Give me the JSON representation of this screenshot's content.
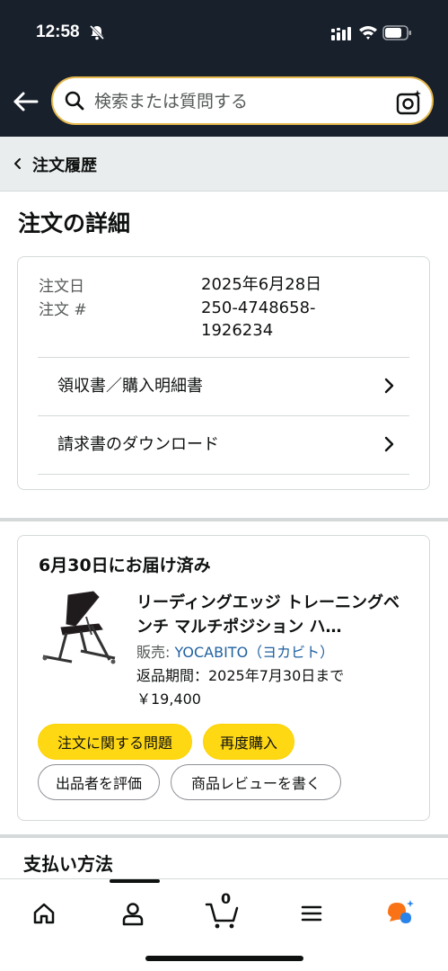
{
  "status_bar": {
    "time": "12:58"
  },
  "search": {
    "placeholder": "検索または質問する"
  },
  "breadcrumb": {
    "label": "注文履歴"
  },
  "page": {
    "title": "注文の詳細"
  },
  "order_info": {
    "date_label": "注文日",
    "date_value": "2025年6月28日",
    "number_label": "注文 #",
    "number_value_line1": "250-4748658-",
    "number_value_line2": "1926234",
    "links": [
      {
        "label": "領収書／購入明細書"
      },
      {
        "label": "請求書のダウンロード"
      }
    ]
  },
  "delivery": {
    "title": "6月30日にお届け済み",
    "product_title": "リーディングエッジ トレーニングベンチ マルチポジション ハ…",
    "seller_label": "販売: ",
    "seller_name": "YOCABITO（ヨカビト）",
    "return_text": "返品期間：2025年7月30日まで",
    "price": "￥19,400",
    "buttons": {
      "problem": "注文に関する問題",
      "rebuy": "再度購入",
      "rate_seller": "出品者を評価",
      "review": "商品レビューを書く"
    }
  },
  "payment": {
    "title": "支払い方法"
  },
  "bottom_nav": {
    "cart_count": "0",
    "icons": [
      "home-icon",
      "account-icon",
      "cart-icon",
      "menu-icon",
      "rufus-icon"
    ]
  },
  "colors": {
    "header_bg": "#18202c",
    "button_yellow": "#ffd814",
    "link_blue": "#2162a1",
    "rufus_orange": "#f97316",
    "rufus_blue": "#2a83e8"
  }
}
